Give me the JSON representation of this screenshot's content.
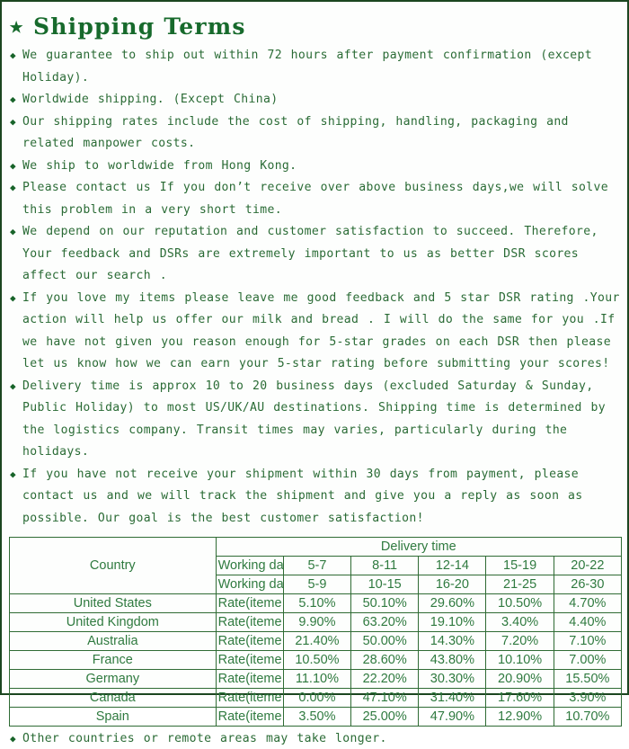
{
  "header": {
    "star_icon": "star-icon",
    "title": "Shipping Terms"
  },
  "bullet_glyph": "◆",
  "terms": [
    "We guarantee to ship out within 72 hours after payment confirmation (except Holiday).",
    "Worldwide shipping.  (Except China)",
    "Our shipping rates include the cost of shipping, handling, packaging and related manpower costs.",
    "We ship to worldwide from Hong Kong.",
    "Please contact us If you don’t receive over above business days,we will solve this problem in a very short time.",
    "We depend on our reputation and customer satisfaction to succeed. Therefore, Your feedback and DSRs are extremely important to us as better DSR scores affect our search .",
    "If you love my items please leave me good feedback and 5 star DSR rating .Your action will help us offer our milk and bread . I will do the same for you .If we have not given you reason enough for 5-star grades on each DSR then please let us know how we can earn your 5-star rating before submitting your scores!",
    "Delivery time is approx 10 to 20 business days (excluded Saturday & Sunday, Public Holiday) to most US/UK/AU destinations. Shipping time is determined by the logistics company. Transit times may varies, particularly during the holidays.",
    "If you have not receive your shipment within 30 days from payment, please contact us and we will track the shipment and give you a reply as soon as possible. Our goal is the best customer satisfaction!"
  ],
  "table": {
    "country_header": "Country",
    "delivery_time_header": "Delivery time",
    "working_days_label": "Working days",
    "working_days_weekend_label": "Working days+Saturday+Sunday",
    "working_days_values": [
      "5-7",
      "8-11",
      "12-14",
      "15-19",
      "20-22"
    ],
    "working_days_weekend_values": [
      "5-9",
      "10-15",
      "16-20",
      "21-25",
      "26-30"
    ],
    "rate_label": "Rate(iteme arrived)",
    "rows": [
      {
        "country": "United States",
        "rates": [
          "5.10%",
          "50.10%",
          "29.60%",
          "10.50%",
          "4.70%"
        ]
      },
      {
        "country": "United Kingdom",
        "rates": [
          "9.90%",
          "63.20%",
          "19.10%",
          "3.40%",
          "4.40%"
        ]
      },
      {
        "country": "Australia",
        "rates": [
          "21.40%",
          "50.00%",
          "14.30%",
          "7.20%",
          "7.10%"
        ]
      },
      {
        "country": "France",
        "rates": [
          "10.50%",
          "28.60%",
          "43.80%",
          "10.10%",
          "7.00%"
        ]
      },
      {
        "country": "Germany",
        "rates": [
          "11.10%",
          "22.20%",
          "30.30%",
          "20.90%",
          "15.50%"
        ]
      },
      {
        "country": "Canada",
        "rates": [
          "0.00%",
          "47.10%",
          "31.40%",
          "17.60%",
          "3.90%"
        ]
      },
      {
        "country": "Spain",
        "rates": [
          "3.50%",
          "25.00%",
          "47.90%",
          "12.90%",
          "10.70%"
        ]
      }
    ]
  },
  "footer_note": "Other countries or remote areas may take longer.",
  "colors": {
    "text_green": "#2a6b35",
    "title_green": "#176a2c",
    "border_green": "#1b4620",
    "table_border": "#2f6b34",
    "table_text": "#2f7a3f"
  }
}
